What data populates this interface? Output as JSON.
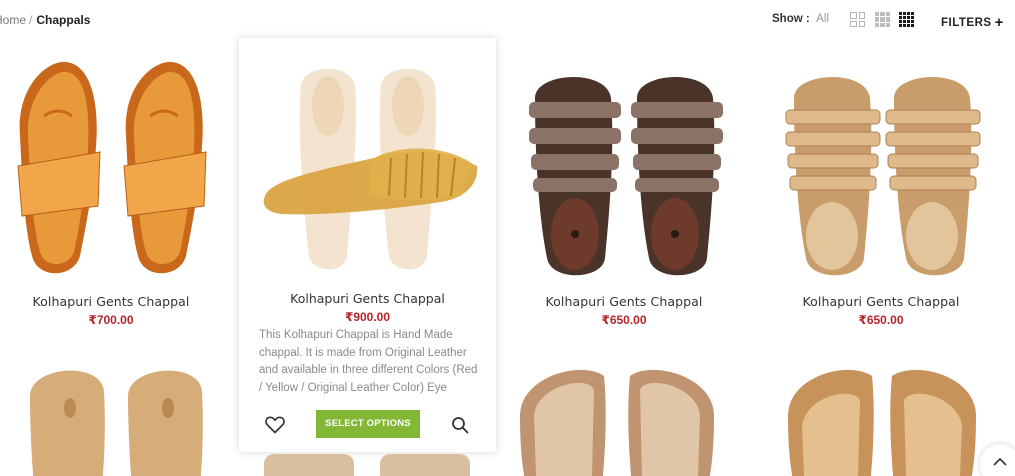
{
  "breadcrumb": {
    "home": "Home",
    "separator": "/",
    "current": "Chappals"
  },
  "toolbar": {
    "show_label": "Show :",
    "show_value": "All",
    "grid_icons": [
      "grid-2-icon",
      "grid-3-icon",
      "grid-4-icon"
    ],
    "active_grid": "grid-4-icon",
    "filters_label": "FILTERS",
    "filters_icon": "plus-icon"
  },
  "products": [
    {
      "name": "Kolhapuri Gents Chappal",
      "price": "₹700.00"
    },
    {
      "name": "Kolhapuri Gents Chappal",
      "price": "₹900.00",
      "description": "This Kolhapuri Chappal is Hand Made chappal. It is made from Original Leather and available in three different Colors (Red / Yellow / Original Leather Color) Eye",
      "select_label": "SELECT OPTIONS",
      "wishlist_icon": "heart-icon",
      "quickview_icon": "search-icon"
    },
    {
      "name": "Kolhapuri Gents Chappal",
      "price": "₹650.00"
    },
    {
      "name": "Kolhapuri Gents Chappal",
      "price": "₹650.00"
    }
  ],
  "colors": {
    "price": "#b5242b",
    "button": "#83b735"
  },
  "scroll_top_icon": "chevron-up-icon"
}
